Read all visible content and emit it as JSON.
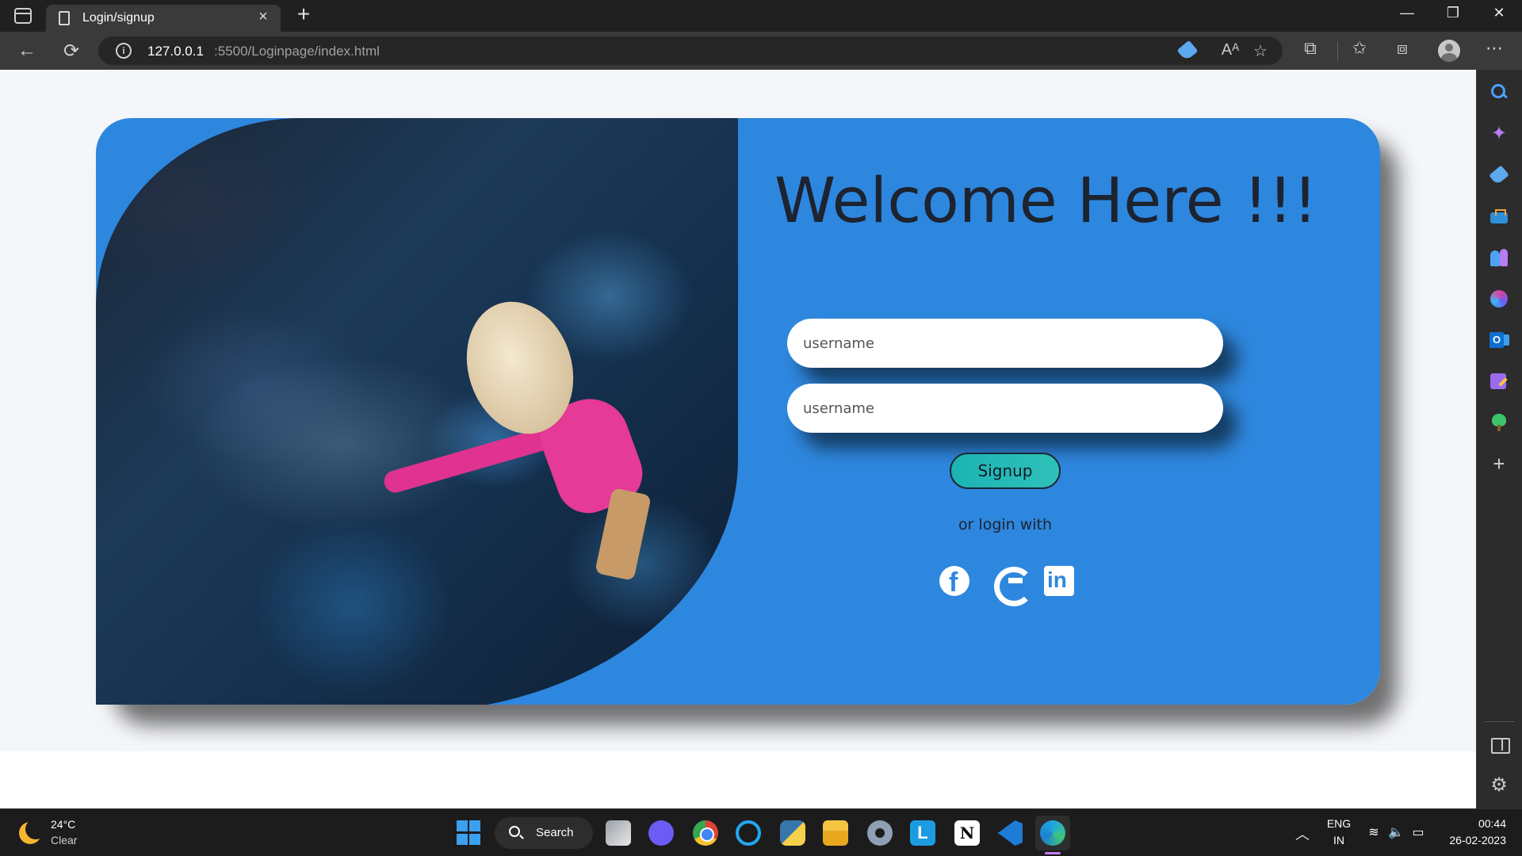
{
  "browser": {
    "tab_title": "Login/signup",
    "new_tab": "+",
    "close_tab": "×",
    "url_host": "127.0.0.1",
    "url_path": ":5500/Loginpage/index.html",
    "window_controls": [
      "—",
      "❐",
      "✕"
    ],
    "nav": {
      "back": "←",
      "reload": "⟳"
    },
    "url_buttons": [
      "Aᴬ",
      "☆"
    ],
    "toolbar_buttons": [
      "⧉",
      "✩",
      "⧈",
      "⋯"
    ]
  },
  "sidebar": {
    "copilot": "✦",
    "add": "+",
    "settings": "⚙"
  },
  "page": {
    "heading": "Welcome Here !!!",
    "username_placeholder": "username",
    "password_placeholder": "username",
    "signup_label": "Signup",
    "or_login_with": "or login with",
    "social": [
      "facebook",
      "google",
      "linkedin"
    ]
  },
  "taskbar": {
    "temperature": "24°C",
    "condition": "Clear",
    "search_label": "Search",
    "notion_letter": "N",
    "launcher_letter": "L",
    "chevron": "︿",
    "lang_line1": "ENG",
    "lang_line2": "IN",
    "tray": [
      "≋",
      "🔈",
      "▭"
    ],
    "time": "00:44",
    "date": "26-02-2023"
  },
  "colors": {
    "card_blue": "#2e87de",
    "signup_teal": "#1bb3b3",
    "heading_text": "#1d2330"
  }
}
